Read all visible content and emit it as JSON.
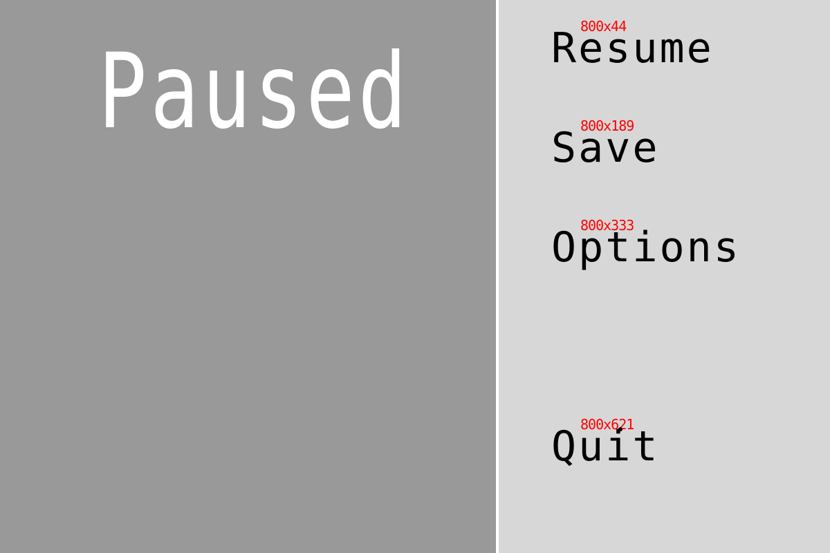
{
  "pause_screen": {
    "title": "Paused"
  },
  "menu": {
    "items": [
      {
        "label": "Resume",
        "coord_tag": "800x44"
      },
      {
        "label": "Save",
        "coord_tag": "800x189"
      },
      {
        "label": "Options",
        "coord_tag": "800x333"
      },
      {
        "label": "Quit",
        "coord_tag": "800x621"
      }
    ]
  },
  "colors": {
    "left_panel_bg": "#999999",
    "right_panel_bg": "#d7d7d7",
    "divider": "#ffffff",
    "title_text": "#ffffff",
    "menu_text": "#000000",
    "coord_tag_text": "#ff0000"
  }
}
